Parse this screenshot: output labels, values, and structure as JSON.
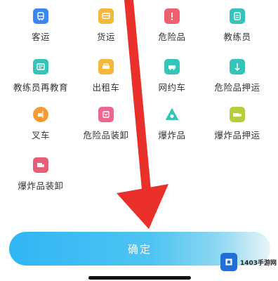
{
  "categories": [
    {
      "label": "客运",
      "icon": "bus-icon",
      "color": "#3b87f2"
    },
    {
      "label": "货运",
      "icon": "truck-icon",
      "color": "#f5b73a"
    },
    {
      "label": "危险品",
      "icon": "hazard-icon",
      "color": "#ee5f72"
    },
    {
      "label": "教练员",
      "icon": "instructor-icon",
      "color": "#34c4b8"
    },
    {
      "label": "教练员再教育",
      "icon": "education-icon",
      "color": "#34c4b8"
    },
    {
      "label": "出租车",
      "icon": "taxi-icon",
      "color": "#f5b73a"
    },
    {
      "label": "网约车",
      "icon": "ride-hailing-icon",
      "color": "#34c4b8"
    },
    {
      "label": "危险品押运",
      "icon": "escort-icon",
      "color": "#34c4b8"
    },
    {
      "label": "叉车",
      "icon": "forklift-icon",
      "color": "#f49a37"
    },
    {
      "label": "危险品装卸",
      "icon": "loading-icon",
      "color": "#ee6590"
    },
    {
      "label": "爆炸品",
      "icon": "explosive-icon",
      "color": "#34c4b8"
    },
    {
      "label": "爆炸品押运",
      "icon": "explosive-escort-icon",
      "color": "#b8cd3d"
    },
    {
      "label": "爆炸品装卸",
      "icon": "explosive-loading-icon",
      "color": "#e65e79"
    }
  ],
  "confirm_label": "确定",
  "watermark": {
    "text": "1403手游网"
  }
}
